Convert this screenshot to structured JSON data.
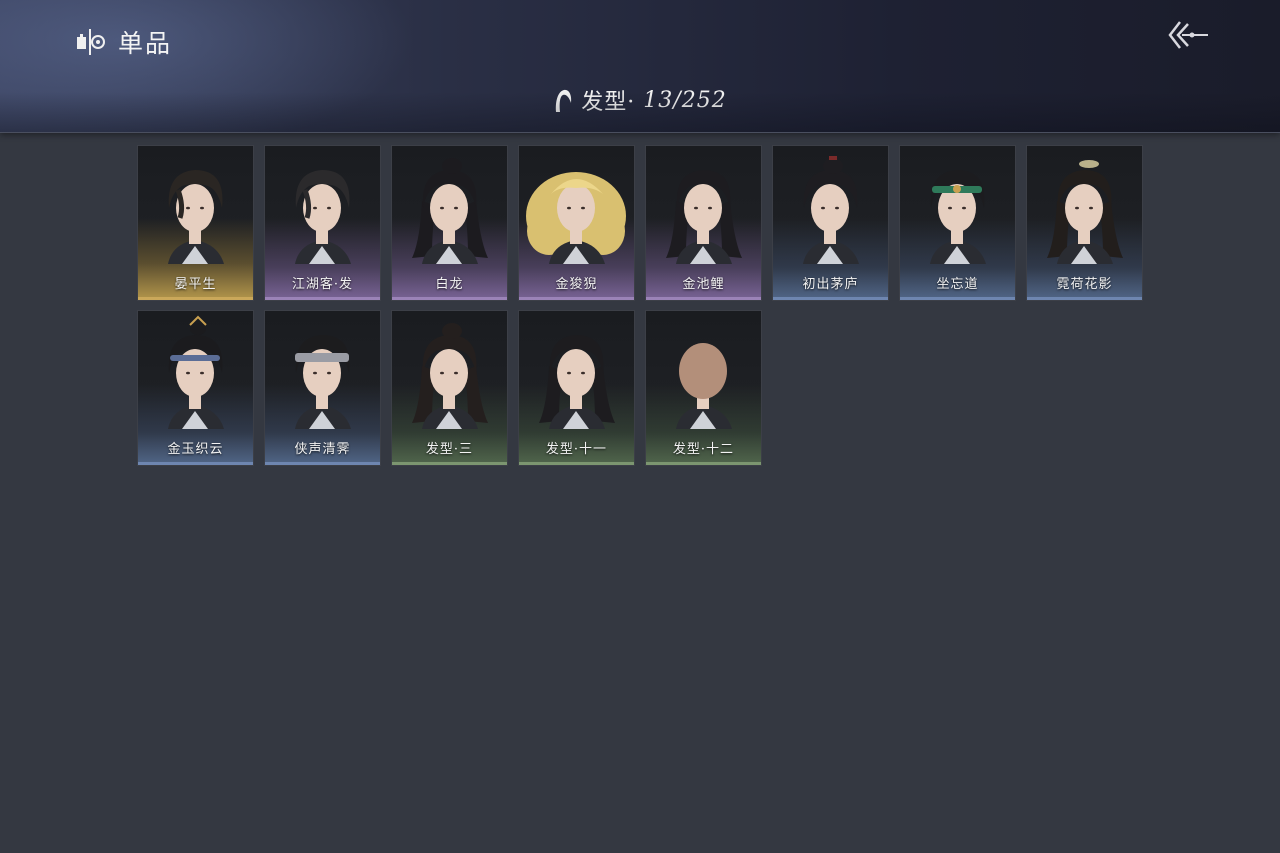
{
  "header": {
    "title": "单品",
    "title_icon": "mirror-frame-icon",
    "back_icon": "back-arrow-icon"
  },
  "category": {
    "icon": "hair-icon",
    "label": "发型·",
    "count": "13/252"
  },
  "rarity_colors": {
    "gold": "#caa85a",
    "purple": "#9b83b8",
    "blue": "#6e86b0",
    "green": "#7c9670"
  },
  "items": [
    {
      "name": "晏平生",
      "rarity": "gold",
      "hair": "#2a2623",
      "style": "tousled"
    },
    {
      "name": "江湖客·发",
      "rarity": "purple",
      "hair": "#2b2a2c",
      "style": "fringe"
    },
    {
      "name": "白龙",
      "rarity": "purple",
      "hair": "#1c1b1f",
      "style": "ponytail"
    },
    {
      "name": "金狻猊",
      "rarity": "purple",
      "hair": "#d9c070",
      "style": "mane"
    },
    {
      "name": "金池鲤",
      "rarity": "purple",
      "hair": "#1d1c20",
      "style": "long"
    },
    {
      "name": "初出茅庐",
      "rarity": "blue",
      "hair": "#1e1d21",
      "style": "bun"
    },
    {
      "name": "坐忘道",
      "rarity": "blue",
      "hair": "#1c1c1f",
      "style": "headband-green"
    },
    {
      "name": "霓荷花影",
      "rarity": "blue",
      "hair": "#221e1c",
      "style": "ornament"
    },
    {
      "name": "金玉织云",
      "rarity": "blue",
      "hair": "#1b1b1e",
      "style": "headband-blue"
    },
    {
      "name": "侠声清霁",
      "rarity": "blue",
      "hair": "#1c1c1e",
      "style": "headband-grey"
    },
    {
      "name": "发型·三",
      "rarity": "green",
      "hair": "#241f1e",
      "style": "ponytail"
    },
    {
      "name": "发型·十一",
      "rarity": "green",
      "hair": "#1d1c1f",
      "style": "long"
    },
    {
      "name": "发型·十二",
      "rarity": "green",
      "hair": "#b38f7a",
      "style": "bald"
    }
  ]
}
